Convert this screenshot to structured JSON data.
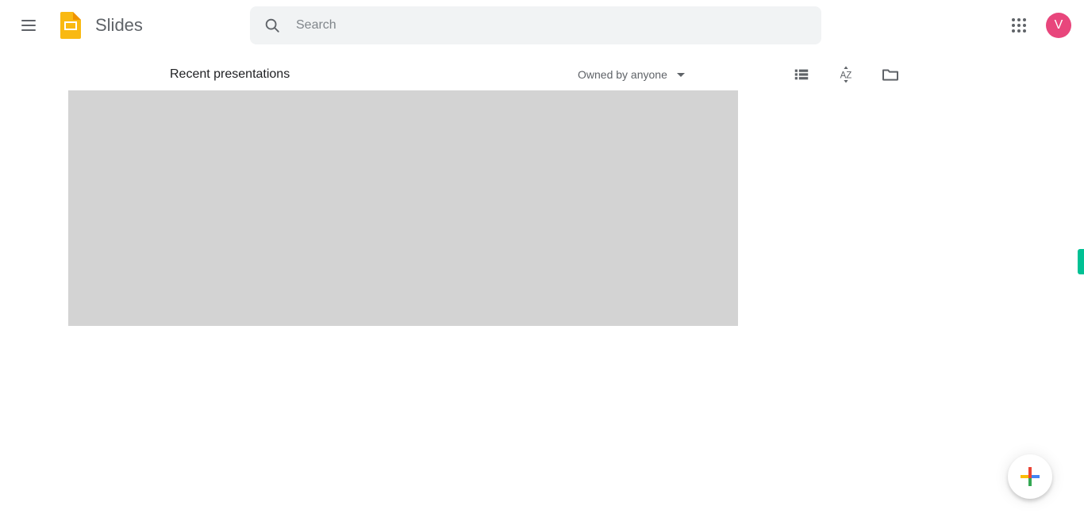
{
  "header": {
    "menu_label": "Main menu",
    "brand": {
      "logo_icon": "slides-logo-icon",
      "name": "Slides",
      "logo_color": "#F4B400"
    },
    "search": {
      "icon": "search-icon",
      "placeholder": "Search",
      "value": ""
    },
    "apps_icon": "apps-grid-icon",
    "avatar": {
      "initial": "V",
      "color": "#E8467C"
    }
  },
  "toolbar": {
    "title": "Recent presentations",
    "owner_filter": {
      "label": "Owned by anyone",
      "caret_icon": "chevron-down-icon"
    },
    "icons": [
      {
        "name": "list-view-icon",
        "tooltip": "List view"
      },
      {
        "name": "sort-az-icon",
        "tooltip": "Sort options"
      },
      {
        "name": "folder-icon",
        "tooltip": "Open file picker"
      }
    ]
  },
  "content": {
    "placeholder_color": "#D3D3D3"
  },
  "side_tab": {
    "name": "feedback-tab",
    "color": "#00C194"
  },
  "fab": {
    "name": "new-presentation-button",
    "icon": "google-plus-icon",
    "colors": {
      "red": "#EA4335",
      "blue": "#4285F4",
      "green": "#34A853",
      "yellow": "#FBBC05"
    }
  }
}
